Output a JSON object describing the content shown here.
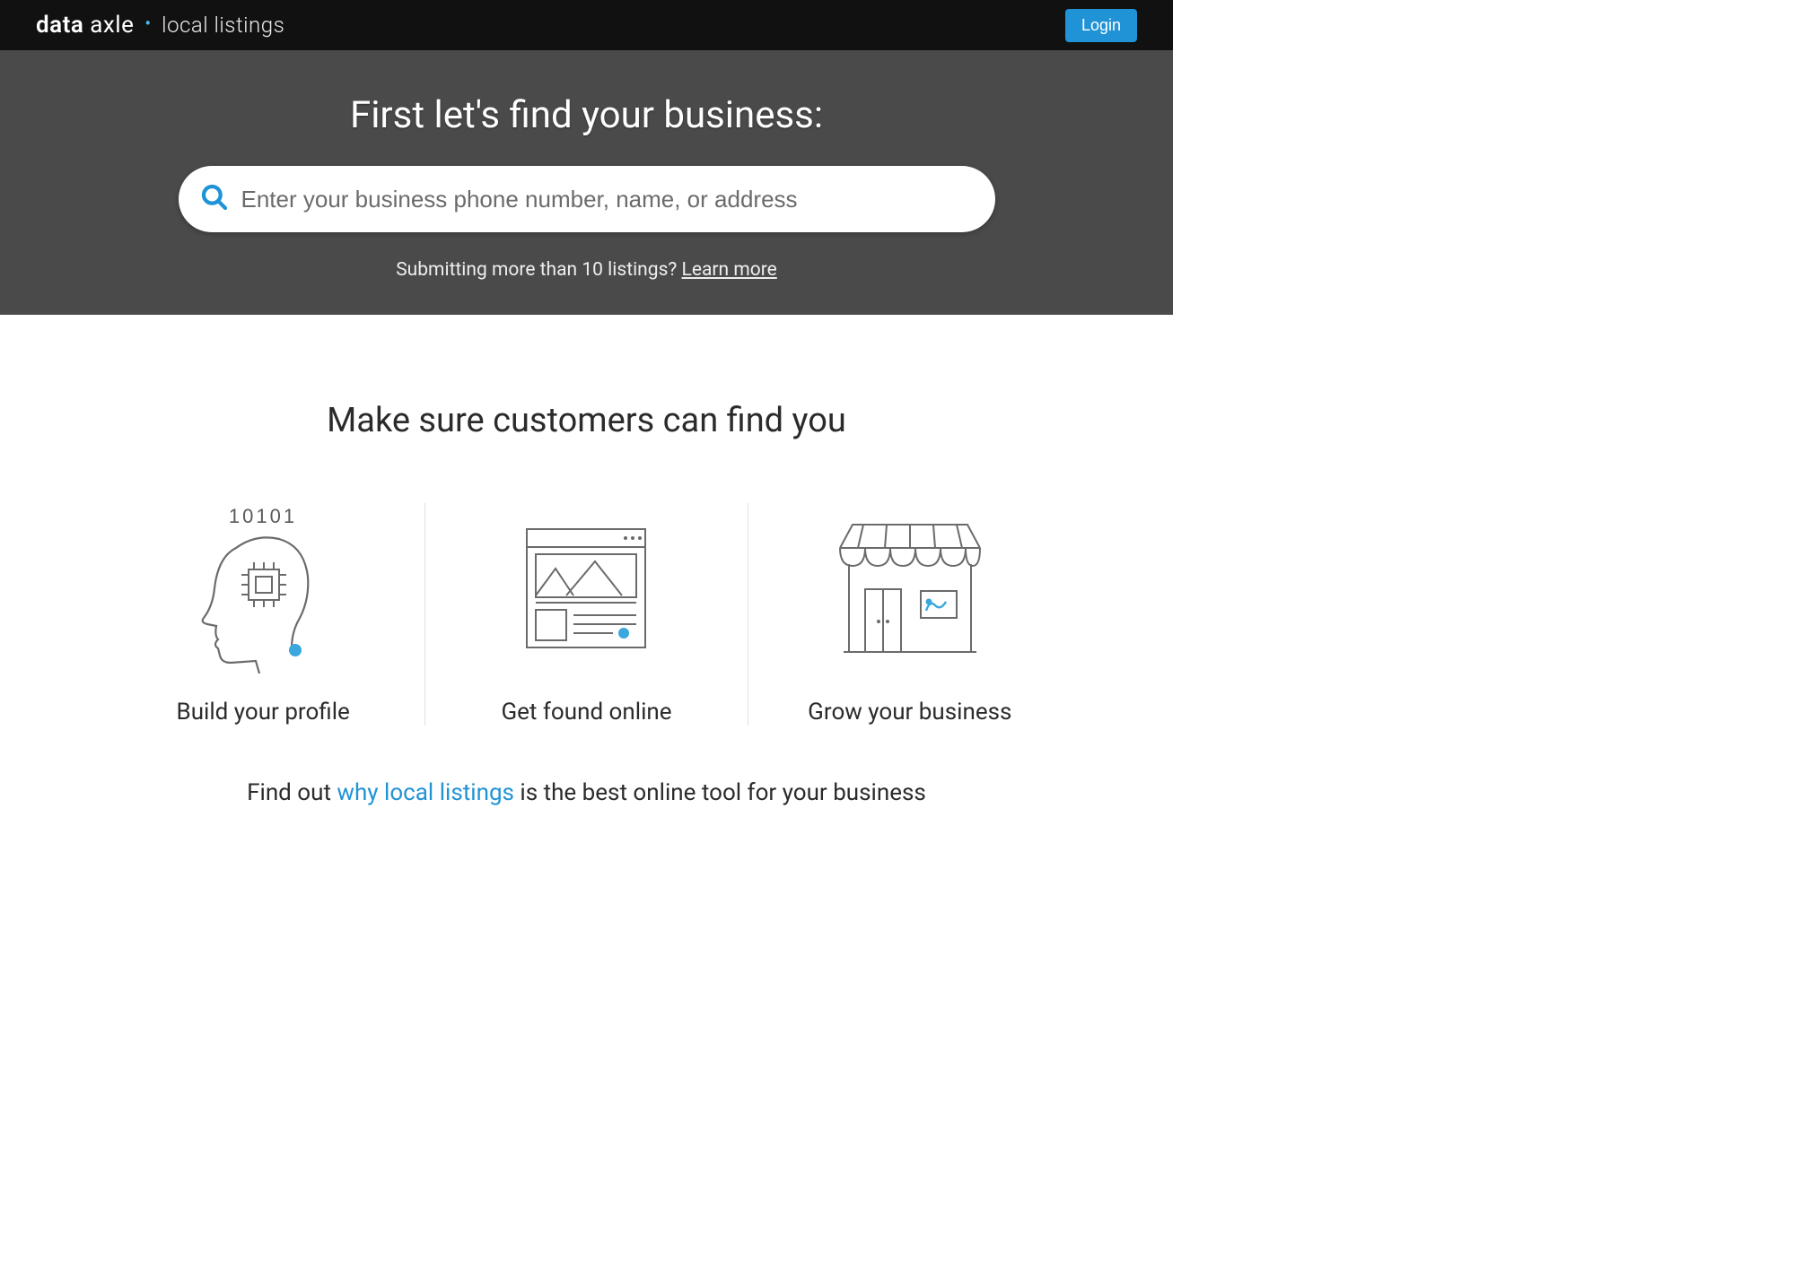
{
  "header": {
    "brand_main": "data axle",
    "brand_sub": "local listings",
    "login_label": "Login"
  },
  "hero": {
    "title": "First let's find your business:",
    "search_placeholder": "Enter your business phone number, name, or address",
    "sub_prefix": "Submitting more than 10 listings? ",
    "sub_link": "Learn more"
  },
  "section": {
    "title": "Make sure customers can find you",
    "features": [
      {
        "title": "Build your profile",
        "icon": "profile-ai-icon",
        "binary_label": "10101"
      },
      {
        "title": "Get found online",
        "icon": "webpage-icon"
      },
      {
        "title": "Grow your business",
        "icon": "storefront-icon"
      }
    ],
    "tagline_prefix": "Find out ",
    "tagline_link": "why local listings",
    "tagline_suffix": " is the best online tool for your business"
  }
}
